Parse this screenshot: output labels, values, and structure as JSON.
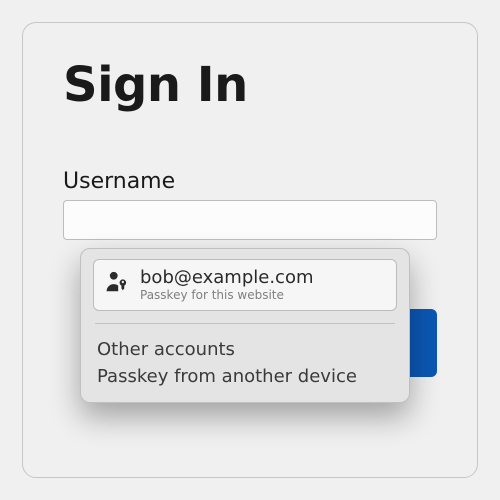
{
  "dialog": {
    "title": "Sign In",
    "username_label": "Username"
  },
  "passkey_popup": {
    "account": {
      "name": "bob@example.com",
      "subtitle": "Passkey for this website"
    },
    "other_accounts_label": "Other accounts",
    "another_device_label": "Passkey from another device"
  }
}
